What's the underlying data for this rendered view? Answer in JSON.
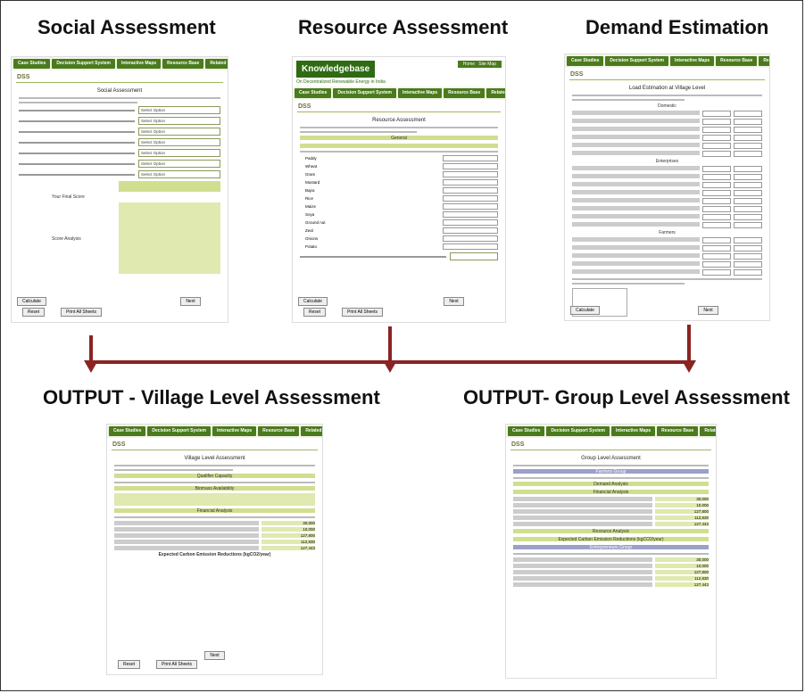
{
  "headings": {
    "social": "Social Assessment",
    "resource": "Resource Assessment",
    "demand": "Demand Estimation",
    "village_output": "OUTPUT - Village Level Assessment",
    "group_output": "OUTPUT- Group Level Assessment"
  },
  "nav": [
    "Case Studies",
    "Decision Support System",
    "Interactive Maps",
    "Resource Base",
    "Related Links"
  ],
  "dss": "DSS",
  "brand": {
    "name": "Knowledgebase",
    "subtitle": "On Decentralized Renewable Energy in India"
  },
  "panels": {
    "social": {
      "title": "Social Assessment",
      "select": "Select Option",
      "final_label": "Your Final Score",
      "analysis_label": "Score Analysis",
      "calc": "Calculate",
      "next": "Next",
      "reset": "Reset",
      "print": "Print All Sheets"
    },
    "resource": {
      "title": "Resource Assessment",
      "general": "General",
      "resource_hdr": "Resource Assessment",
      "crops": [
        "Paddy",
        "Wheat",
        "Gram",
        "Mustard",
        "Bajra",
        "Rice",
        "Maize",
        "Soya",
        "Ground nut",
        "Zeal",
        "Onions",
        "Potato"
      ],
      "calc": "Calculate",
      "next": "Next",
      "reset": "Reset",
      "print": "Print All Sheets"
    },
    "demand": {
      "title": "Load Estimation at Village Level",
      "domestic": "Domestic",
      "enterprises": "Enterprises",
      "farmers": "Farmers",
      "calc": "Calculate",
      "next": "Next"
    },
    "village": {
      "title": "Village Level Assessment",
      "qualifier": "Qualifier Capacity",
      "biomass": "Biomass Availability",
      "financial": "Financial Analysis",
      "carbon": "Expected Carbon Emission Reductions (kgCO2/year)",
      "values": [
        "30,000",
        "10,000",
        "127,800",
        "112,830",
        "127,443"
      ],
      "next": "Next",
      "reset": "Reset",
      "print": "Print All Sheets"
    },
    "group": {
      "title": "Group Level Assessment",
      "farmers_group": "Farmers Group",
      "demand": "Demand Analysis",
      "financial": "Financial Analysis",
      "resource": "Resource Analysis",
      "carbon": "Expected Carbon Emission Reductions (kgCO2/year)",
      "entre_group": "Entrepreneurs Group",
      "values": [
        "30,000",
        "10,000",
        "127,800",
        "112,830",
        "127,443"
      ]
    }
  },
  "colors": {
    "nav": "#4a7b1d",
    "arrow": "#8b2323",
    "accent": "#cfdf8f"
  }
}
